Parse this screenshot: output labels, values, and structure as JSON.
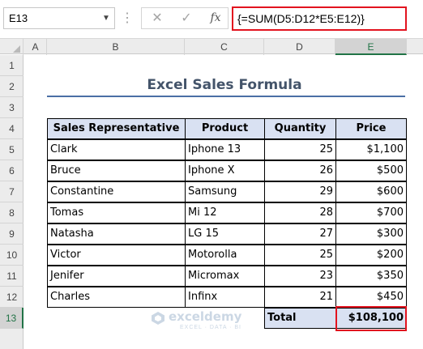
{
  "formula_bar": {
    "name_box": "E13",
    "formula": "{=SUM(D5:D12*E5:E12)}",
    "fx_label": "fx",
    "cancel_glyph": "✕",
    "enter_glyph": "✓",
    "icons": [
      "chevron-down-icon",
      "more-icon",
      "cancel-icon",
      "enter-icon",
      "fx-icon"
    ]
  },
  "columns": [
    "A",
    "B",
    "C",
    "D",
    "E"
  ],
  "selected_column": "E",
  "rows": [
    "1",
    "2",
    "3",
    "4",
    "5",
    "6",
    "7",
    "8",
    "9",
    "10",
    "11",
    "12",
    "13"
  ],
  "selected_row": "13",
  "sheet": {
    "title": "Excel Sales Formula",
    "headers": [
      "Sales Representative",
      "Product",
      "Quantity",
      "Price"
    ],
    "records": [
      [
        "Clark",
        "Iphone 13",
        "25",
        "$1,100"
      ],
      [
        "Bruce",
        "Iphone X",
        "26",
        "$500"
      ],
      [
        "Constantine",
        "Samsung",
        "29",
        "$600"
      ],
      [
        "Tomas",
        "Mi 12",
        "28",
        "$700"
      ],
      [
        "Natasha",
        "LG 15",
        "27",
        "$300"
      ],
      [
        "Victor",
        "Motorolla",
        "25",
        "$200"
      ],
      [
        "Jenifer",
        "Micromax",
        "23",
        "$350"
      ],
      [
        "Charles",
        "Infinx",
        "21",
        "$450"
      ]
    ],
    "total_label": "Total",
    "total_value": "$108,100"
  },
  "watermark": {
    "name": "exceldemy",
    "tagline": "EXCEL · DATA · BI"
  },
  "colors": {
    "highlight": "#e2131f",
    "header_fill": "#d9e1f2",
    "title": "#44546a",
    "selection": "#217346"
  }
}
